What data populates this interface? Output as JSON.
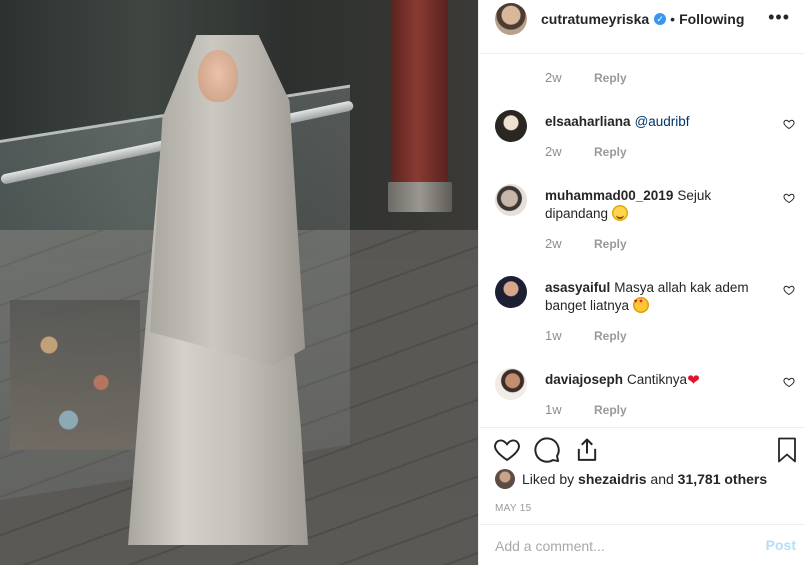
{
  "post": {
    "username": "cutratumeyriska",
    "separator": "•",
    "follow_state": "Following",
    "more_icon": "more-options-icon"
  },
  "comments": {
    "first_meta": {
      "time": "2w",
      "reply": "Reply"
    },
    "items": [
      {
        "user": "elsaaharliana",
        "mention": "@audribf",
        "text": "",
        "time": "2w",
        "reply": "Reply"
      },
      {
        "user": "muhammad00_2019",
        "mention": "",
        "text": "Sejuk dipandang",
        "emoji": "smiling-face-with-blush",
        "time": "2w",
        "reply": "Reply"
      },
      {
        "user": "asasyaiful",
        "mention": "",
        "text": "Masya allah kak adem banget liatnya",
        "emoji": "smiling-face-with-heart-eyes",
        "time": "1w",
        "reply": "Reply"
      },
      {
        "user": "daviajoseph",
        "mention": "",
        "text": "Cantiknya",
        "emoji": "red-heart",
        "time": "1w",
        "reply": "Reply"
      }
    ]
  },
  "actions": {
    "like_icon": "heart-outline-icon",
    "comment_icon": "comment-bubble-icon",
    "share_icon": "share-icon",
    "save_icon": "bookmark-icon"
  },
  "likes": {
    "prefix": "Liked by",
    "user": "shezaidris",
    "connector": "and",
    "others": "31,781 others"
  },
  "date": "MAY 15",
  "add_comment": {
    "placeholder": "Add a comment...",
    "post_label": "Post"
  },
  "colors": {
    "link_blue": "#003569",
    "verified_blue": "#3897f0",
    "post_disabled": "#b2dffc",
    "meta_gray": "#8e8e8e"
  }
}
